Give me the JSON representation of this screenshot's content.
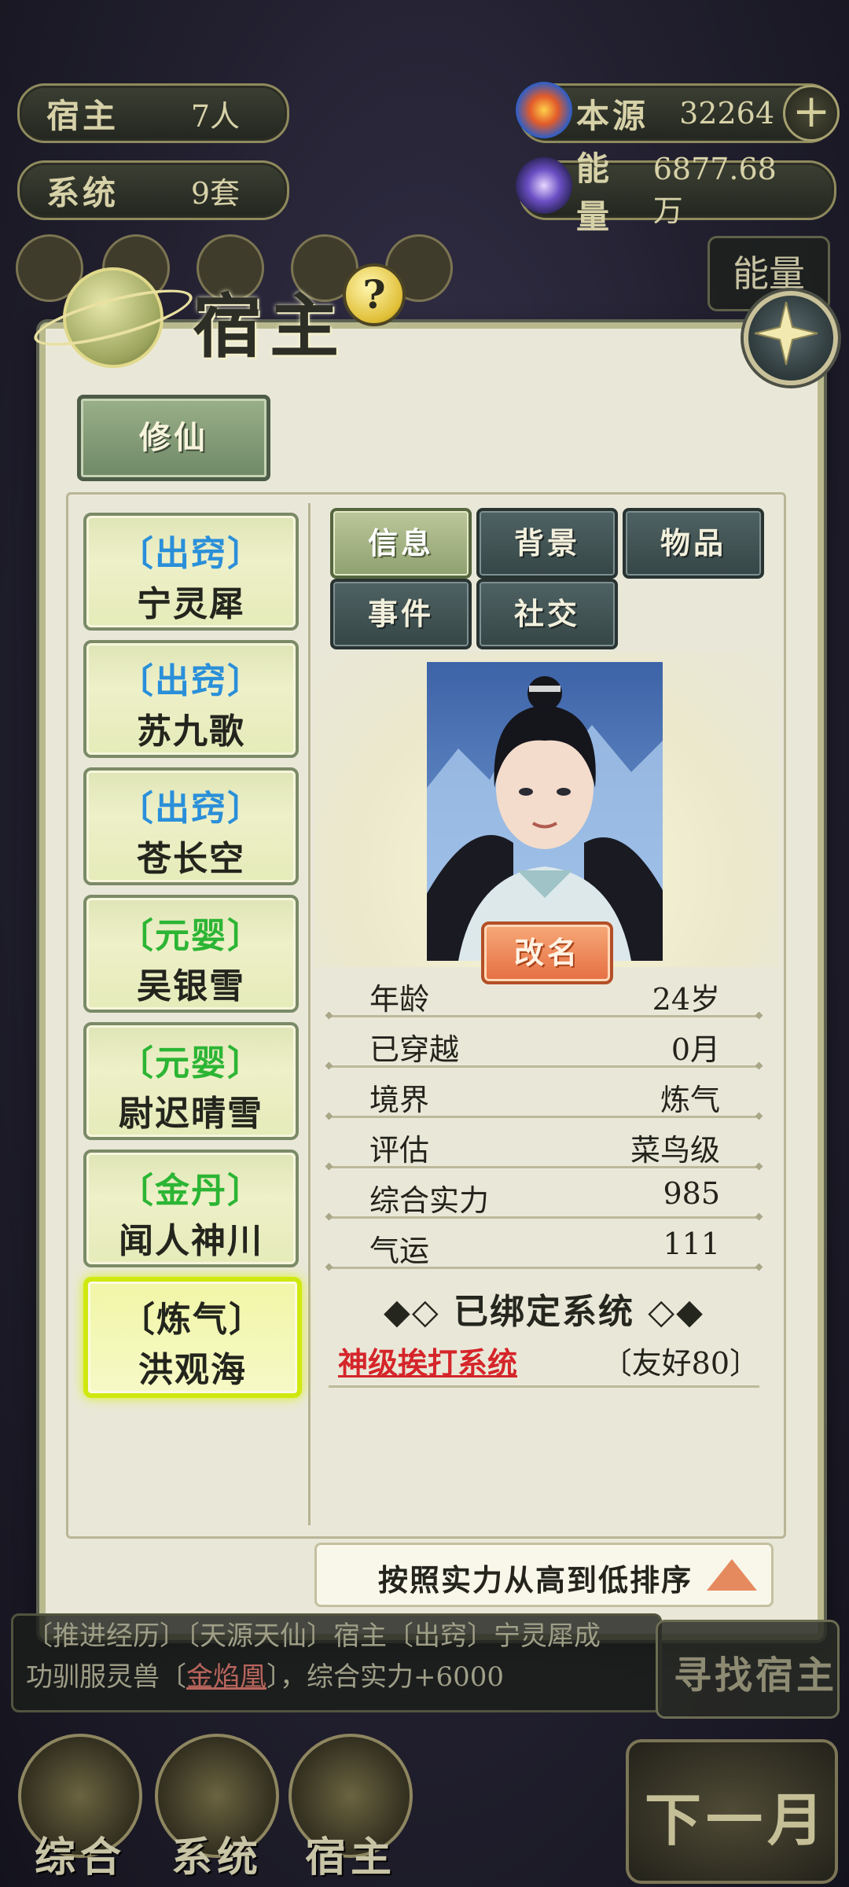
{
  "top_stats": {
    "host": {
      "label": "宿主",
      "value": "7人"
    },
    "system": {
      "label": "系统",
      "value": "9套"
    },
    "origin": {
      "label": "本源",
      "value": "32264"
    },
    "energy": {
      "label": "能量",
      "value": "6877.68万"
    }
  },
  "panel": {
    "title": "宿主",
    "help": "?",
    "category": "修仙"
  },
  "hosts": [
    {
      "realm": "〔出窍〕",
      "name": "宁灵犀",
      "color": "#2a8fd9"
    },
    {
      "realm": "〔出窍〕",
      "name": "苏九歌",
      "color": "#2a8fd9"
    },
    {
      "realm": "〔出窍〕",
      "name": "苍长空",
      "color": "#2a8fd9"
    },
    {
      "realm": "〔元婴〕",
      "name": "吴银雪",
      "color": "#2cb534"
    },
    {
      "realm": "〔元婴〕",
      "name": "尉迟晴雪",
      "color": "#2cb534"
    },
    {
      "realm": "〔金丹〕",
      "name": "闻人神川",
      "color": "#2cb534"
    },
    {
      "realm": "〔炼气〕",
      "name": "洪观海",
      "color": "#23251d"
    }
  ],
  "tabs": [
    "信息",
    "背景",
    "物品",
    "事件",
    "社交"
  ],
  "rename": "改名",
  "stats": [
    {
      "key": "年龄",
      "value": "24岁"
    },
    {
      "key": "已穿越",
      "value": "0月"
    },
    {
      "key": "境界",
      "value": "炼气"
    },
    {
      "key": "评估",
      "value": "菜鸟级"
    },
    {
      "key": "综合实力",
      "value": "985"
    },
    {
      "key": "气运",
      "value": "111"
    }
  ],
  "bound": {
    "title": "◆◇ 已绑定系统 ◇◆",
    "system_name": "神级挨打系统",
    "relation": "〔友好80〕"
  },
  "sort_label": "按照实力从高到低排序",
  "log": {
    "line1": "〔推进经历〕〔天源天仙〕宿主〔出窍〕宁灵犀成",
    "line2_prefix": "功驯服灵兽〔",
    "line2_highlight": "金焰凰",
    "line2_suffix": "〕，综合实力+6000"
  },
  "side": {
    "find_host": "寻找宿主",
    "energy_short": "能量"
  },
  "bottom_nav": [
    "综合",
    "系统",
    "宿主"
  ],
  "next_month": "下一月"
}
